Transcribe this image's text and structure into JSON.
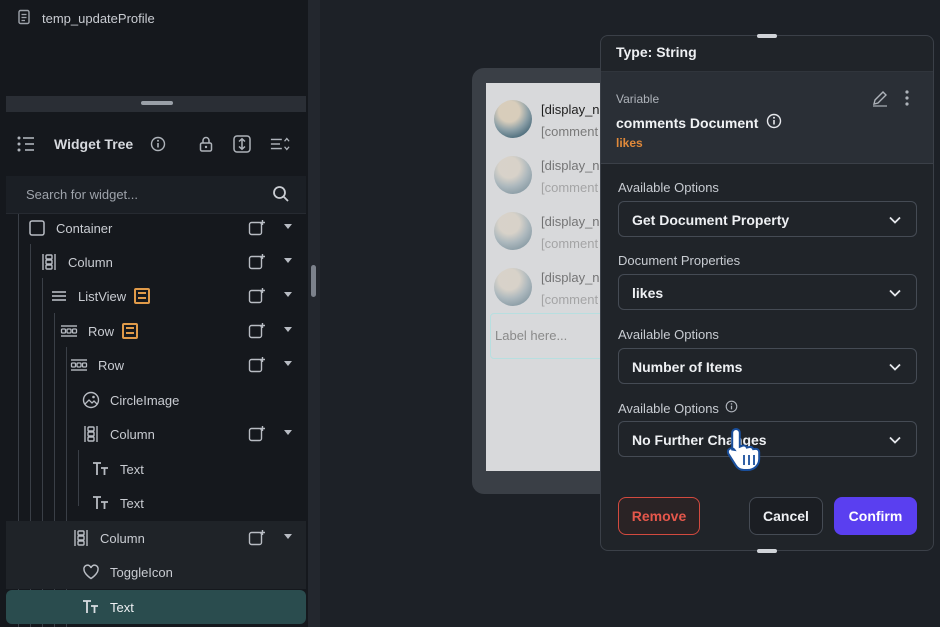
{
  "explorer": {
    "file_name": "temp_updateProfile"
  },
  "widget_tree": {
    "title": "Widget Tree",
    "search_placeholder": "Search for widget...",
    "items": [
      {
        "label": "Container"
      },
      {
        "label": "Column"
      },
      {
        "label": "ListView"
      },
      {
        "label": "Row"
      },
      {
        "label": "Row"
      },
      {
        "label": "CircleImage"
      },
      {
        "label": "Column"
      },
      {
        "label": "Text"
      },
      {
        "label": "Text"
      },
      {
        "label": "Column"
      },
      {
        "label": "ToggleIcon"
      },
      {
        "label": "Text"
      }
    ]
  },
  "preview": {
    "rows": [
      {
        "line1": "[display_n",
        "line2": "[comment"
      },
      {
        "line1": "[display_n",
        "line2": "[comment"
      },
      {
        "line1": "[display_n",
        "line2": "[comment"
      },
      {
        "line1": "[display_n",
        "line2": "[comment"
      }
    ],
    "input_placeholder": "Label here..."
  },
  "popup": {
    "type_label": "Type: String",
    "variable_caption": "Variable",
    "variable_name": "comments Document",
    "variable_field": "likes",
    "sections": [
      {
        "label": "Available Options",
        "value": "Get Document Property"
      },
      {
        "label": "Document Properties",
        "value": "likes"
      },
      {
        "label": "Available Options",
        "value": "Number of Items"
      },
      {
        "label": "Available Options",
        "value": "No Further Changes"
      }
    ],
    "remove_label": "Remove",
    "cancel_label": "Cancel",
    "confirm_label": "Confirm"
  },
  "colors": {
    "accent": "#5a3ff0",
    "danger": "#e5574b",
    "field_orange": "#e0893a",
    "selection": "#2a4c4e"
  }
}
